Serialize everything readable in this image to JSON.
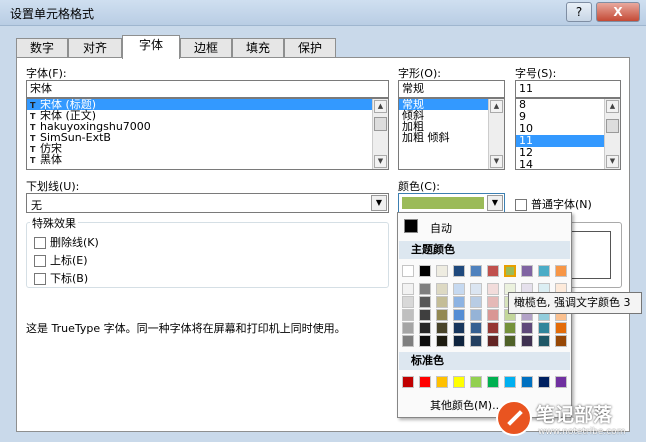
{
  "window": {
    "title": "设置单元格格式",
    "help": "?",
    "close": "X"
  },
  "tabs": [
    "数字",
    "对齐",
    "字体",
    "边框",
    "填充",
    "保护"
  ],
  "font": {
    "label": "字体(F):",
    "value": "宋体",
    "items": [
      "宋体 (标题)",
      "宋体 (正文)",
      "hakuyoxingshu7000",
      "SimSun-ExtB",
      "仿宋",
      "黑体"
    ]
  },
  "style": {
    "label": "字形(O):",
    "value": "常规",
    "items": [
      "常规",
      "倾斜",
      "加粗",
      "加粗 倾斜"
    ]
  },
  "size": {
    "label": "字号(S):",
    "value": "11",
    "items": [
      "8",
      "9",
      "10",
      "11",
      "12",
      "14"
    ]
  },
  "underline": {
    "label": "下划线(U):",
    "value": "无"
  },
  "color": {
    "label": "颜色(C):",
    "value_color": "#9bbb59"
  },
  "normal_font": "普通字体(N)",
  "effects": {
    "title": "特殊效果",
    "strike": "删除线(K)",
    "super": "上标(E)",
    "sub": "下标(B)"
  },
  "description": "这是 TrueType 字体。同一种字体将在屏幕和打印机上同时使用。",
  "picker": {
    "auto": "自动",
    "theme_title": "主题颜色",
    "standard_title": "标准色",
    "more": "其他颜色(M)...",
    "theme_top": [
      "#ffffff",
      "#000000",
      "#eeece1",
      "#1f497d",
      "#4f81bd",
      "#c0504d",
      "#9bbb59",
      "#8064a2",
      "#4bacc6",
      "#f79646"
    ],
    "theme_cols": [
      [
        "#f2f2f2",
        "#d8d8d8",
        "#bfbfbf",
        "#a5a5a5",
        "#7f7f7f"
      ],
      [
        "#7f7f7f",
        "#595959",
        "#3f3f3f",
        "#262626",
        "#0c0c0c"
      ],
      [
        "#ddd9c3",
        "#c4bd97",
        "#938953",
        "#494429",
        "#1d1b10"
      ],
      [
        "#c6d9f0",
        "#8db3e2",
        "#548dd4",
        "#17365d",
        "#0f243e"
      ],
      [
        "#dbe5f1",
        "#b8cce4",
        "#95b3d7",
        "#366092",
        "#244061"
      ],
      [
        "#f2dcdb",
        "#e5b9b7",
        "#d99694",
        "#953734",
        "#632423"
      ],
      [
        "#ebf1dd",
        "#d7e3bc",
        "#c3d69b",
        "#76923c",
        "#4f6128"
      ],
      [
        "#e5e0ec",
        "#ccc1d9",
        "#b2a2c7",
        "#5f497a",
        "#3f3151"
      ],
      [
        "#dbeef3",
        "#b7dde8",
        "#92cddc",
        "#31859b",
        "#205867"
      ],
      [
        "#fdeada",
        "#fbd5b5",
        "#fac08f",
        "#e36c09",
        "#974806"
      ]
    ],
    "standard": [
      "#c00000",
      "#ff0000",
      "#ffc000",
      "#ffff00",
      "#92d050",
      "#00b050",
      "#00b0f0",
      "#0070c0",
      "#002060",
      "#7030a0"
    ]
  },
  "tooltip": "橄榄色, 强调文字颜色 3",
  "watermark": {
    "text": "笔记部落",
    "url": "www.notetribe.com"
  }
}
